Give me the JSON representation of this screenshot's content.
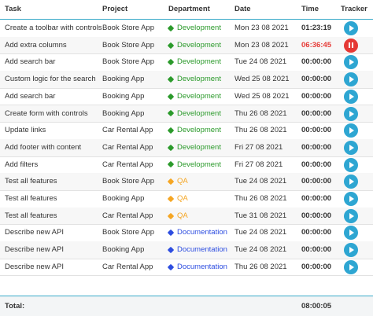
{
  "columns": {
    "task": "Task",
    "project": "Project",
    "department": "Department",
    "date": "Date",
    "time": "Time",
    "tracker": "Tracker"
  },
  "colors": {
    "Development": "#2b9a2b",
    "QA": "#f5a623",
    "Documentation": "#2d4de0",
    "accent": "#2ea6d2",
    "running": "#e53935"
  },
  "rows": [
    {
      "task": "Create a toolbar with controls",
      "project": "Book Store App",
      "department": "Development",
      "date": "Mon 23 08 2021",
      "time": "01:23:19",
      "running": false
    },
    {
      "task": "Add extra columns",
      "project": "Book Store App",
      "department": "Development",
      "date": "Mon 23 08 2021",
      "time": "06:36:45",
      "running": true
    },
    {
      "task": "Add search bar",
      "project": "Book Store App",
      "department": "Development",
      "date": "Tue 24 08 2021",
      "time": "00:00:00",
      "running": false
    },
    {
      "task": "Custom logic for the search",
      "project": "Booking App",
      "department": "Development",
      "date": "Wed 25 08 2021",
      "time": "00:00:00",
      "running": false
    },
    {
      "task": "Add search bar",
      "project": "Booking App",
      "department": "Development",
      "date": "Wed 25 08 2021",
      "time": "00:00:00",
      "running": false
    },
    {
      "task": "Create form with controls",
      "project": "Booking App",
      "department": "Development",
      "date": "Thu 26 08 2021",
      "time": "00:00:00",
      "running": false
    },
    {
      "task": "Update links",
      "project": "Car Rental App",
      "department": "Development",
      "date": "Thu 26 08 2021",
      "time": "00:00:00",
      "running": false
    },
    {
      "task": "Add footer with content",
      "project": "Car Rental App",
      "department": "Development",
      "date": "Fri 27 08 2021",
      "time": "00:00:00",
      "running": false
    },
    {
      "task": "Add filters",
      "project": "Car Rental App",
      "department": "Development",
      "date": "Fri 27 08 2021",
      "time": "00:00:00",
      "running": false
    },
    {
      "task": "Test all features",
      "project": "Book Store App",
      "department": "QA",
      "date": "Tue 24 08 2021",
      "time": "00:00:00",
      "running": false
    },
    {
      "task": "Test all features",
      "project": "Booking App",
      "department": "QA",
      "date": "Thu 26 08 2021",
      "time": "00:00:00",
      "running": false
    },
    {
      "task": "Test all features",
      "project": "Car Rental App",
      "department": "QA",
      "date": "Tue 31 08 2021",
      "time": "00:00:00",
      "running": false
    },
    {
      "task": "Describe new API",
      "project": "Book Store App",
      "department": "Documentation",
      "date": "Tue 24 08 2021",
      "time": "00:00:00",
      "running": false
    },
    {
      "task": "Describe new API",
      "project": "Booking App",
      "department": "Documentation",
      "date": "Tue 24 08 2021",
      "time": "00:00:00",
      "running": false
    },
    {
      "task": "Describe new API",
      "project": "Car Rental App",
      "department": "Documentation",
      "date": "Thu 26 08 2021",
      "time": "00:00:00",
      "running": false
    }
  ],
  "footer": {
    "label": "Total:",
    "total": "08:00:05"
  }
}
